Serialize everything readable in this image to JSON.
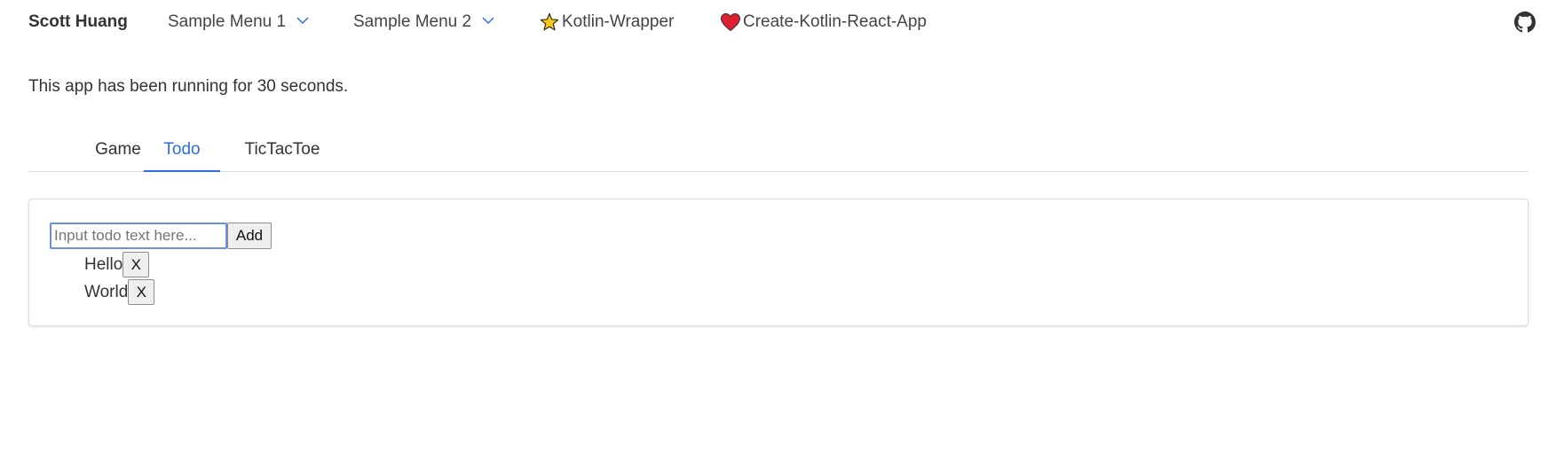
{
  "nav": {
    "brand": "Scott Huang",
    "menu1": "Sample Menu 1",
    "menu2": "Sample Menu 2",
    "link1": "Kotlin-Wrapper",
    "link2": "Create-Kotlin-React-App",
    "link1_icon": "star-icon",
    "link2_icon": "heart-icon",
    "github_icon": "github-icon"
  },
  "status": {
    "text": "This app has been running for 30 seconds."
  },
  "tabs": [
    {
      "label": "Game",
      "active": false
    },
    {
      "label": "Todo",
      "active": true
    },
    {
      "label": "TicTacToe",
      "active": false
    }
  ],
  "todo": {
    "placeholder": "Input todo text here...",
    "value": "",
    "add_label": "Add",
    "items": [
      {
        "text": "Hello",
        "remove_label": "X"
      },
      {
        "text": "World",
        "remove_label": "X"
      }
    ]
  },
  "colors": {
    "accent": "#2e6ce0",
    "star": "#f5c518",
    "heart": "#e0202e"
  }
}
